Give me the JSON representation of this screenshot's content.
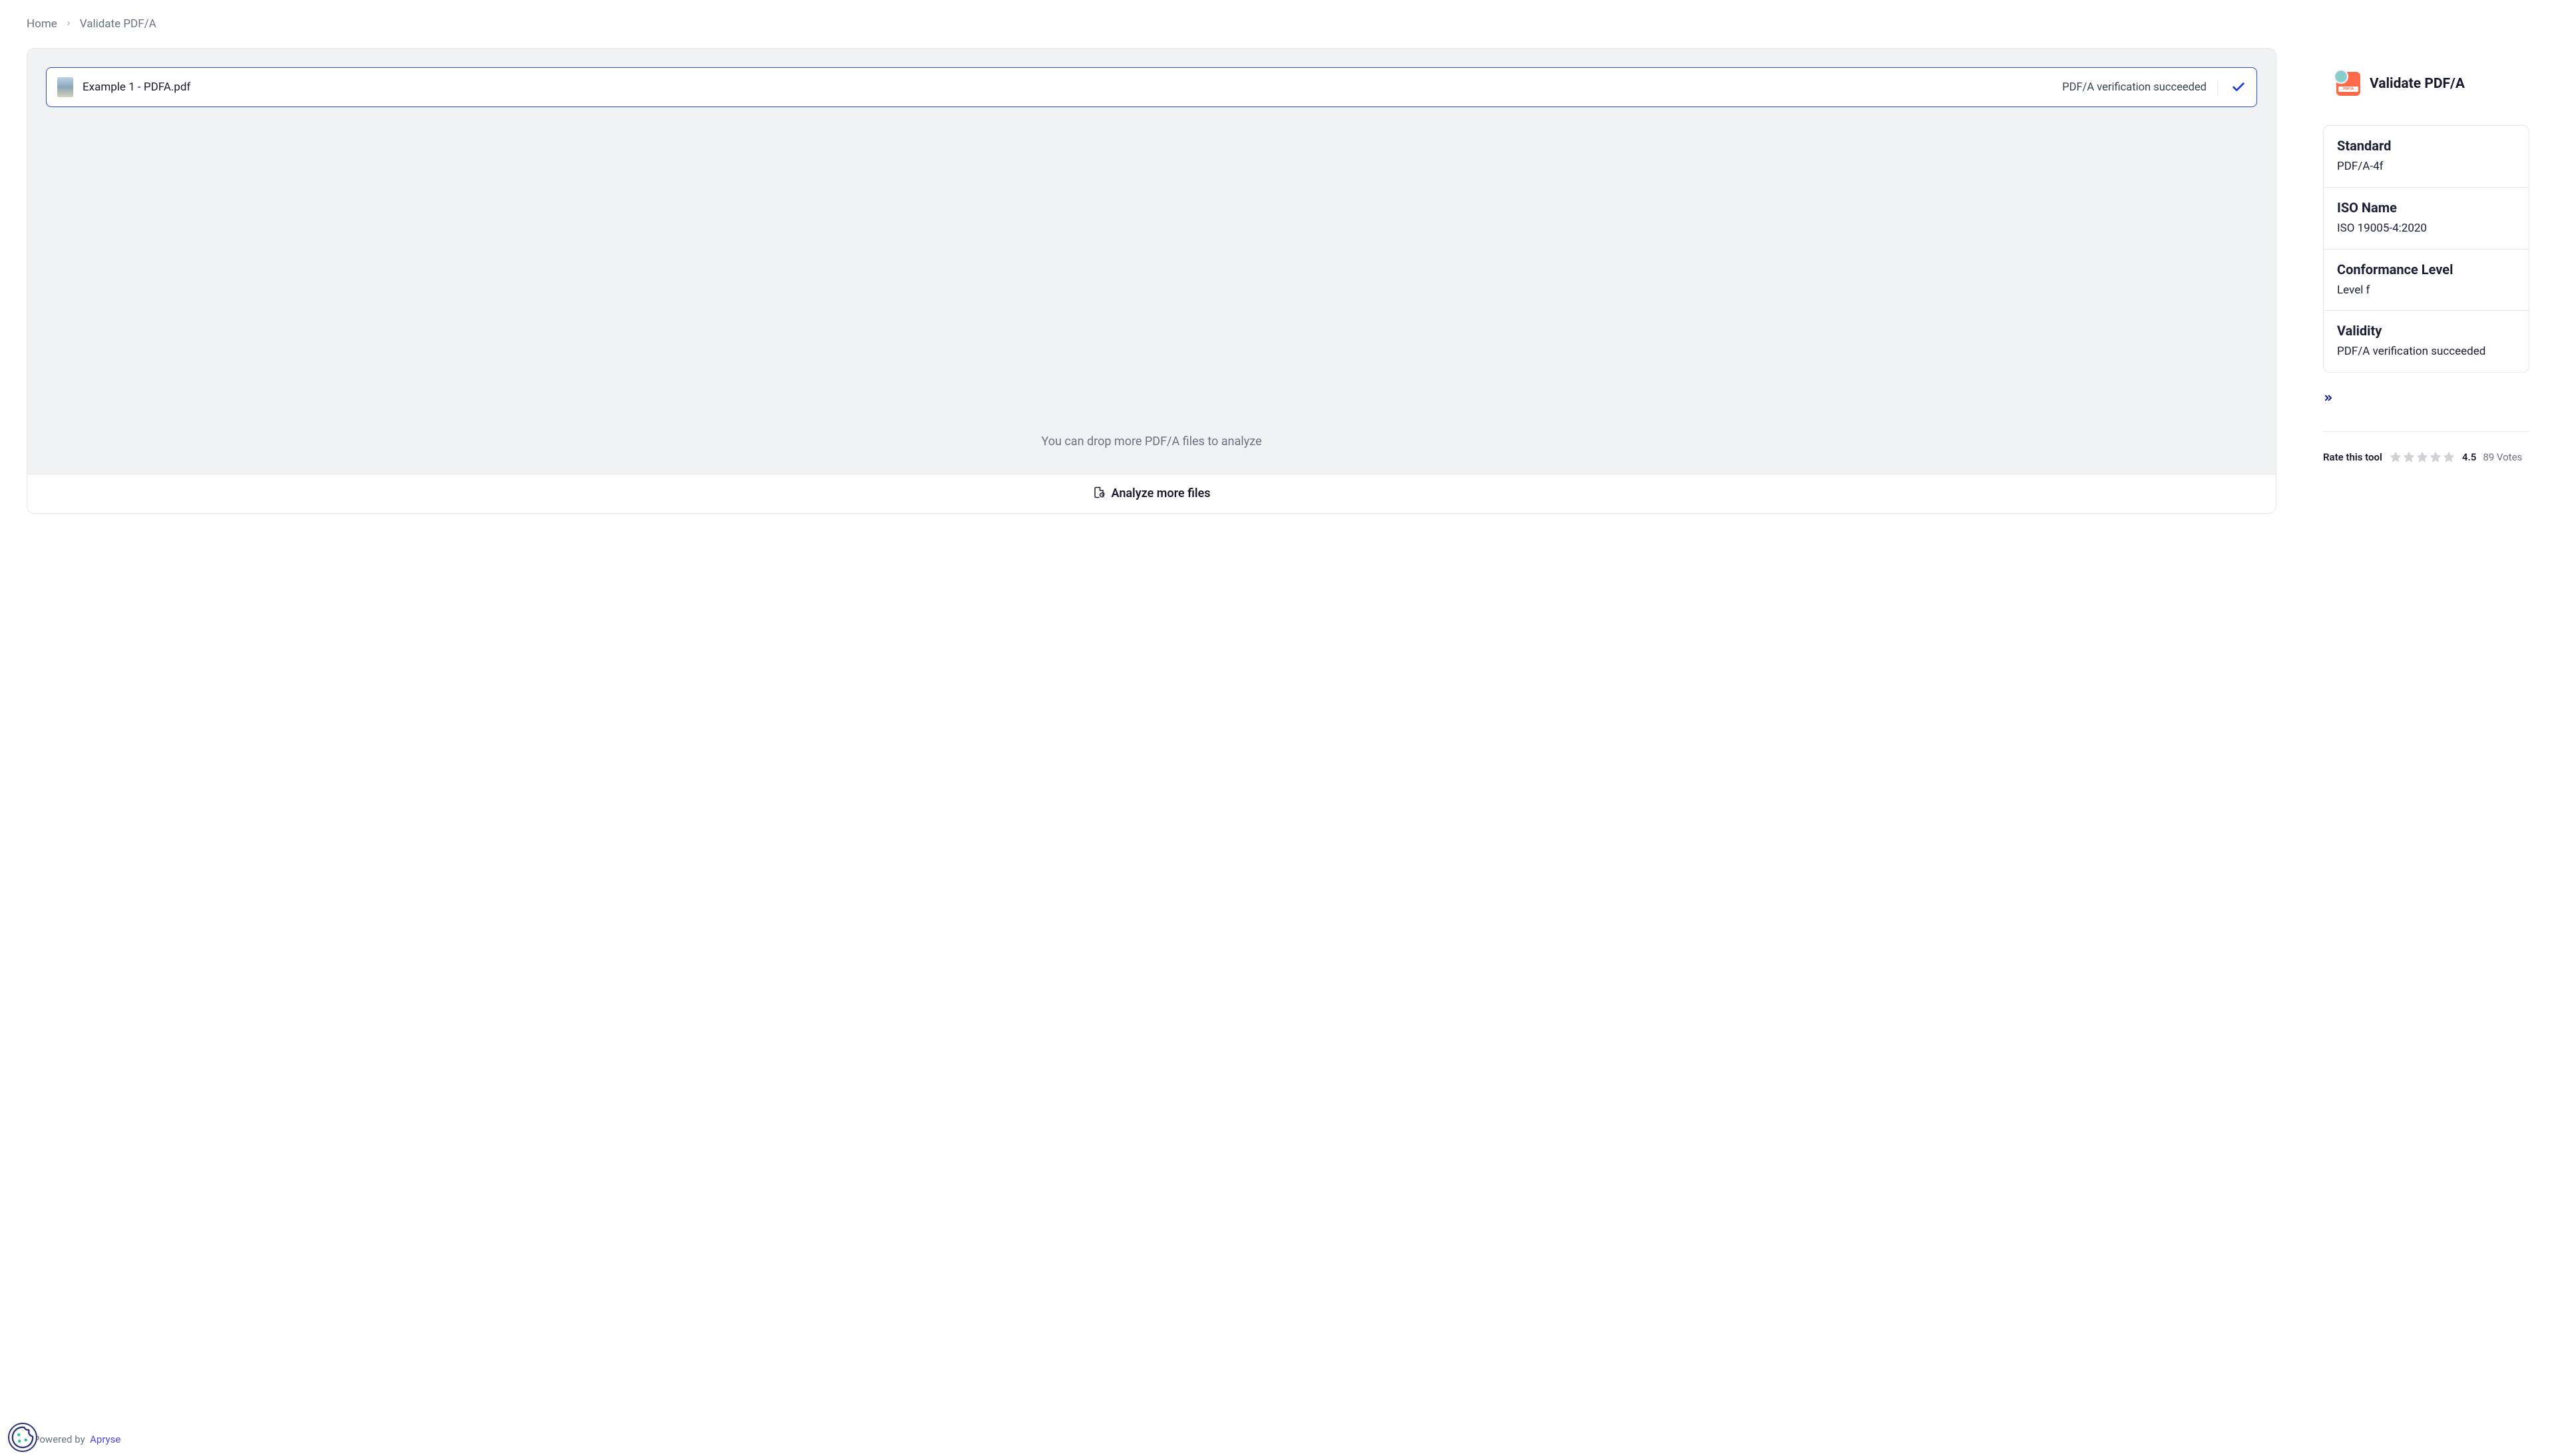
{
  "breadcrumb": {
    "home": "Home",
    "current": "Validate PDF/A"
  },
  "file": {
    "name": "Example 1 - PDFA.pdf",
    "status": "PDF/A verification succeeded"
  },
  "drop_hint": "You can drop more PDF/A files to analyze",
  "analyze_more": "Analyze more files",
  "side": {
    "title": "Validate PDF/A",
    "sections": [
      {
        "label": "Standard",
        "value": "PDF/A-4f"
      },
      {
        "label": "ISO Name",
        "value": "ISO 19005-4:2020"
      },
      {
        "label": "Conformance Level",
        "value": "Level f"
      },
      {
        "label": "Validity",
        "value": "PDF/A verification succeeded"
      }
    ]
  },
  "rating": {
    "label": "Rate this tool",
    "score": "4.5",
    "votes": "89 Votes"
  },
  "powered_by": {
    "prefix": "Powered by",
    "name": "Apryse"
  }
}
